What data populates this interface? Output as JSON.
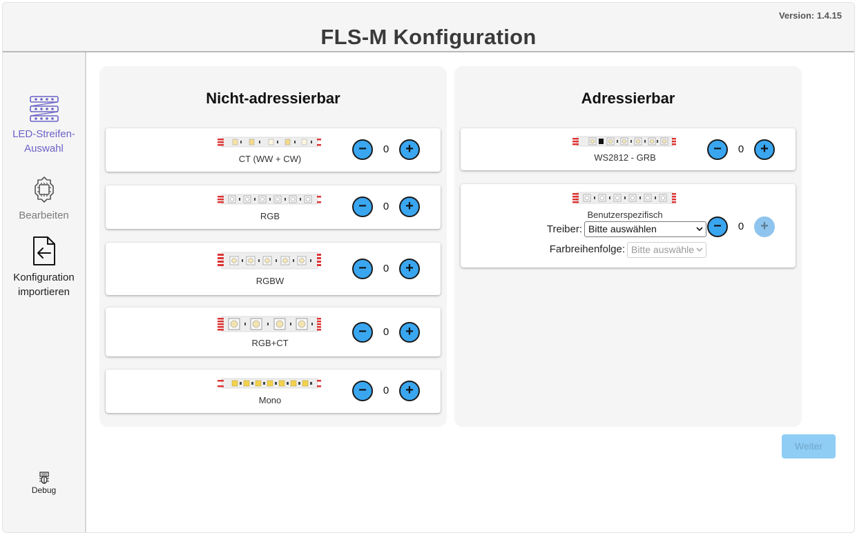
{
  "header": {
    "version": "Version: 1.4.15",
    "title": "FLS-M Konfiguration"
  },
  "sidebar": {
    "items": [
      {
        "label": "LED-Streifen-Auswahl",
        "icon": "led-strip-icon"
      },
      {
        "label": "Bearbeiten",
        "icon": "chip-gear-icon"
      },
      {
        "label": "Konfiguration importieren",
        "icon": "file-import-icon"
      },
      {
        "label": "Debug",
        "icon": "bug-icon"
      }
    ]
  },
  "non_addressable": {
    "title": "Nicht-adressierbar",
    "strips": [
      {
        "label": "CT (WW + CW)",
        "count": "0"
      },
      {
        "label": "RGB",
        "count": "0"
      },
      {
        "label": "RGBW",
        "count": "0"
      },
      {
        "label": "RGB+CT",
        "count": "0"
      },
      {
        "label": "Mono",
        "count": "0"
      }
    ]
  },
  "addressable": {
    "title": "Adressierbar",
    "strips": [
      {
        "label": "WS2812 - GRB",
        "count": "0"
      },
      {
        "label": "Benutzerspezifisch",
        "count": "0"
      }
    ],
    "custom": {
      "driver_label": "Treiber:",
      "driver_value": "Bitte auswählen",
      "order_label": "Farbreihenfolge:",
      "order_value": "Bitte auswähle"
    }
  },
  "footer": {
    "next_label": "Weiter"
  },
  "colors": {
    "accent": "#3aa6f0",
    "nav_active": "#6b62c7",
    "button_disabled": "#8fcdf5"
  }
}
